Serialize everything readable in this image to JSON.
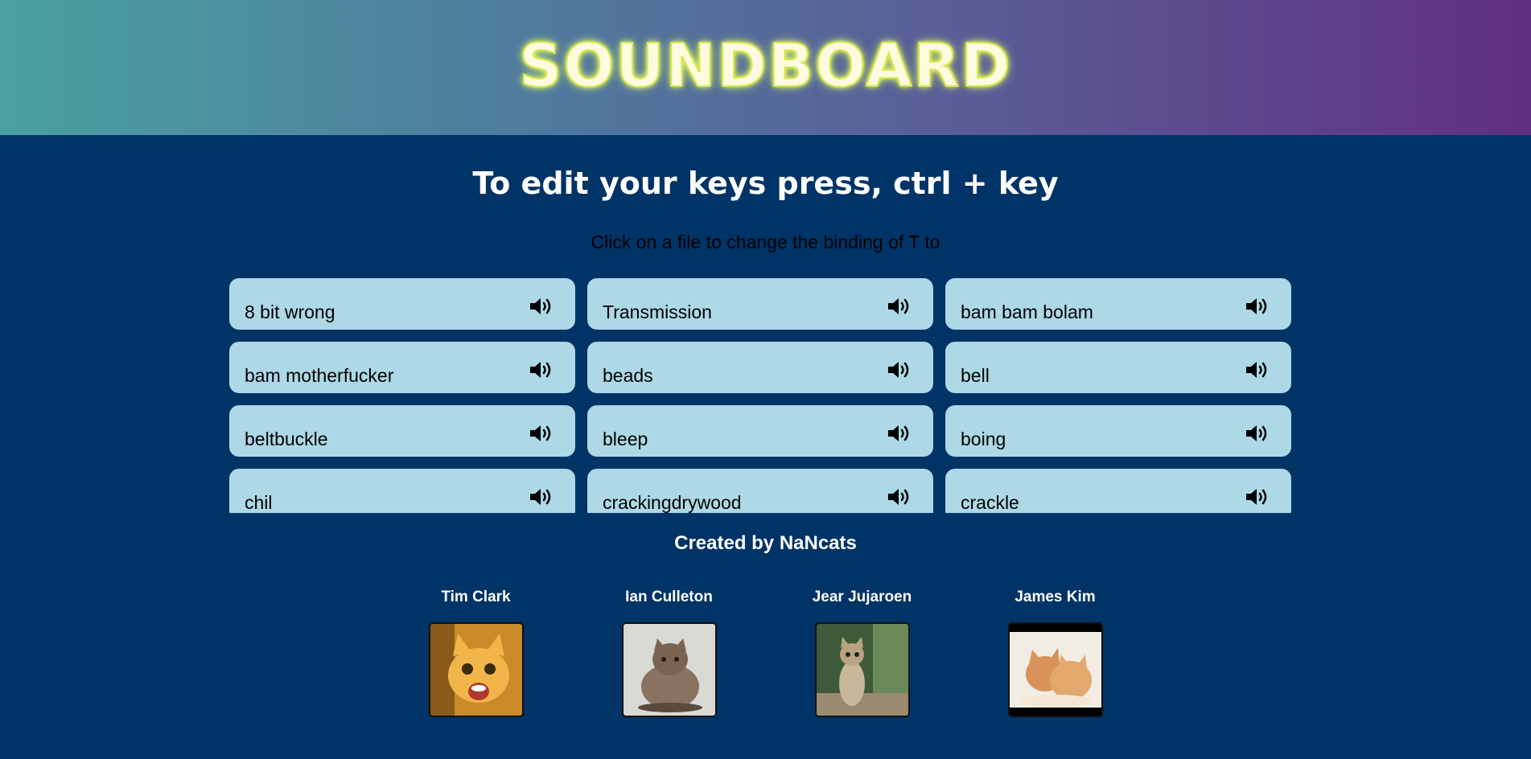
{
  "header": {
    "logo_text": "SOUNDBOARD"
  },
  "instructions": {
    "edit_title": "To edit your keys press, ctrl + key",
    "binding_hint": "Click on a file to change the binding of T to"
  },
  "sounds": [
    {
      "label": "8 bit wrong",
      "icon": "speaker-icon"
    },
    {
      "label": "Transmission",
      "icon": "speaker-icon"
    },
    {
      "label": "bam bam bolam",
      "icon": "speaker-icon"
    },
    {
      "label": "bam motherfucker",
      "icon": "speaker-icon"
    },
    {
      "label": "beads",
      "icon": "speaker-icon"
    },
    {
      "label": "bell",
      "icon": "speaker-icon"
    },
    {
      "label": "beltbuckle",
      "icon": "speaker-icon"
    },
    {
      "label": "bleep",
      "icon": "speaker-icon"
    },
    {
      "label": "boing",
      "icon": "speaker-icon"
    },
    {
      "label": "chil",
      "icon": "speaker-icon"
    },
    {
      "label": "crackingdrywood",
      "icon": "speaker-icon"
    },
    {
      "label": "crackle",
      "icon": "speaker-icon"
    }
  ],
  "credits": {
    "title": "Created by NaNcats",
    "members": [
      {
        "name": "Tim Clark",
        "avatar": "orange-kitten-photo"
      },
      {
        "name": "Ian Culleton",
        "avatar": "fluffy-grey-cat-photo"
      },
      {
        "name": "Jear Jujaroen",
        "avatar": "kitten-standing-photo"
      },
      {
        "name": "James Kim",
        "avatar": "two-kittens-photo"
      }
    ]
  },
  "colors": {
    "background": "#003366",
    "tile": "#add8e6",
    "header_gradient_start": "#4aa0a0",
    "header_gradient_end": "#612f82",
    "logo_glow": "#d9e84a"
  }
}
